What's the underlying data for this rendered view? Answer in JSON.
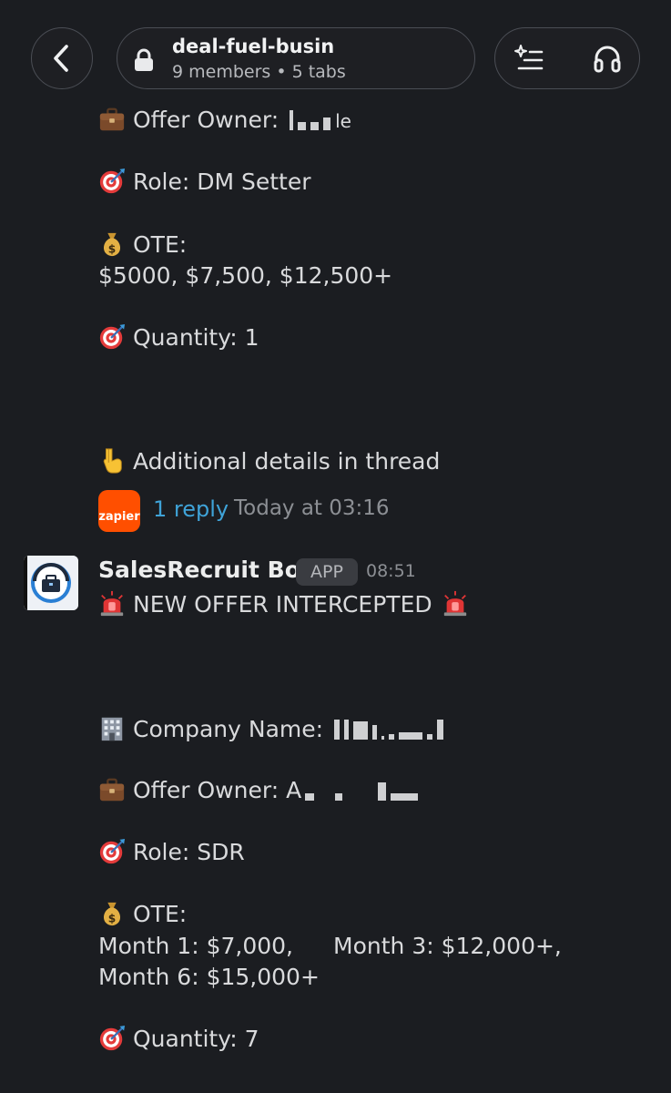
{
  "header": {
    "back_icon": "chevron-left-icon",
    "channel_name": "deal-fuel-busin",
    "channel_meta": "9 members • 5 tabs",
    "ai_summary_icon": "sparkle-list-icon",
    "huddle_icon": "headphones-icon"
  },
  "message1": {
    "offer_owner_label": "Offer Owner: ",
    "offer_owner_tail": "le",
    "role": "Role: DM Setter",
    "ote_label": "OTE:",
    "ote_values": "$5000, $7,500, $12,500+",
    "quantity": "Quantity: 1",
    "thread_note": "Additional details in thread",
    "zapier_label": "zapier",
    "reply_count": "1 reply",
    "reply_time": "Today at 03:16"
  },
  "message2": {
    "sender": "SalesRecruit Bot",
    "badge": "APP",
    "time": "08:51",
    "headline": "NEW OFFER INTERCEPTED",
    "company_label": "Company Name: ",
    "offer_owner_label": "Offer Owner: ",
    "offer_owner_initial": "A",
    "role": "Role: SDR",
    "ote_label": "OTE:",
    "ote_line1_a": "Month 1: $7,000,",
    "ote_line1_b": "Month 3: $12,000+,",
    "ote_line2": "Month 6: $15,000+",
    "quantity": "Quantity: 7"
  },
  "colors": {
    "background": "#1b1d21",
    "link": "#3fa3d8",
    "zapier": "#ff4f00"
  }
}
